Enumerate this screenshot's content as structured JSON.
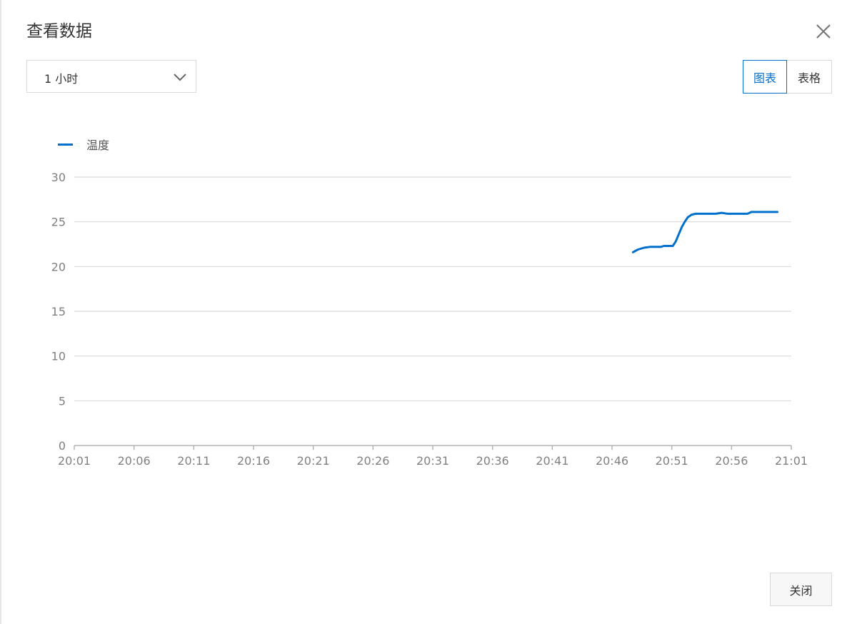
{
  "dialog": {
    "title": "查看数据",
    "close_icon": "close-icon"
  },
  "range_select": {
    "value": "1 小时",
    "icon": "chevron-down-icon"
  },
  "view_toggle": {
    "chart_label": "图表",
    "table_label": "表格",
    "active": "chart"
  },
  "footer": {
    "close_label": "关闭"
  },
  "colors": {
    "accent": "#0070cc",
    "grid": "#d9d9d9",
    "axis_text": "#808080"
  },
  "chart_data": {
    "type": "line",
    "title": "",
    "xlabel": "",
    "ylabel": "",
    "ylim": [
      0,
      30
    ],
    "yticks": [
      "0",
      "5",
      "10",
      "15",
      "20",
      "25",
      "30"
    ],
    "xlim_minutes": [
      0,
      60
    ],
    "xticks": [
      "20:01",
      "20:06",
      "20:11",
      "20:16",
      "20:21",
      "20:26",
      "20:31",
      "20:36",
      "20:41",
      "20:46",
      "20:51",
      "20:56",
      "21:01"
    ],
    "grid": true,
    "legend_position": "top-left",
    "series": [
      {
        "name": "温度",
        "color": "#0070cc",
        "x": [
          "20:47:45",
          "20:48:10",
          "20:48:40",
          "20:49:10",
          "20:49:40",
          "20:50:05",
          "20:50:20",
          "20:50:35",
          "20:50:50",
          "20:51:05",
          "20:51:20",
          "20:51:35",
          "20:51:50",
          "20:52:05",
          "20:52:20",
          "20:52:40",
          "20:53:00",
          "20:53:40",
          "20:54:10",
          "20:54:40",
          "20:55:10",
          "20:55:40",
          "20:56:05",
          "20:56:20",
          "20:56:40",
          "20:57:00",
          "20:57:20",
          "20:57:40",
          "20:58:10",
          "20:58:40",
          "20:59:05",
          "20:59:30",
          "20:59:50"
        ],
        "y": [
          21.6,
          21.9,
          22.1,
          22.2,
          22.2,
          22.2,
          22.3,
          22.3,
          22.3,
          22.3,
          22.8,
          23.6,
          24.4,
          25.0,
          25.5,
          25.8,
          25.9,
          25.9,
          25.9,
          25.9,
          26.0,
          25.9,
          25.9,
          25.9,
          25.9,
          25.9,
          25.9,
          26.1,
          26.1,
          26.1,
          26.1,
          26.1,
          26.1
        ]
      }
    ]
  }
}
